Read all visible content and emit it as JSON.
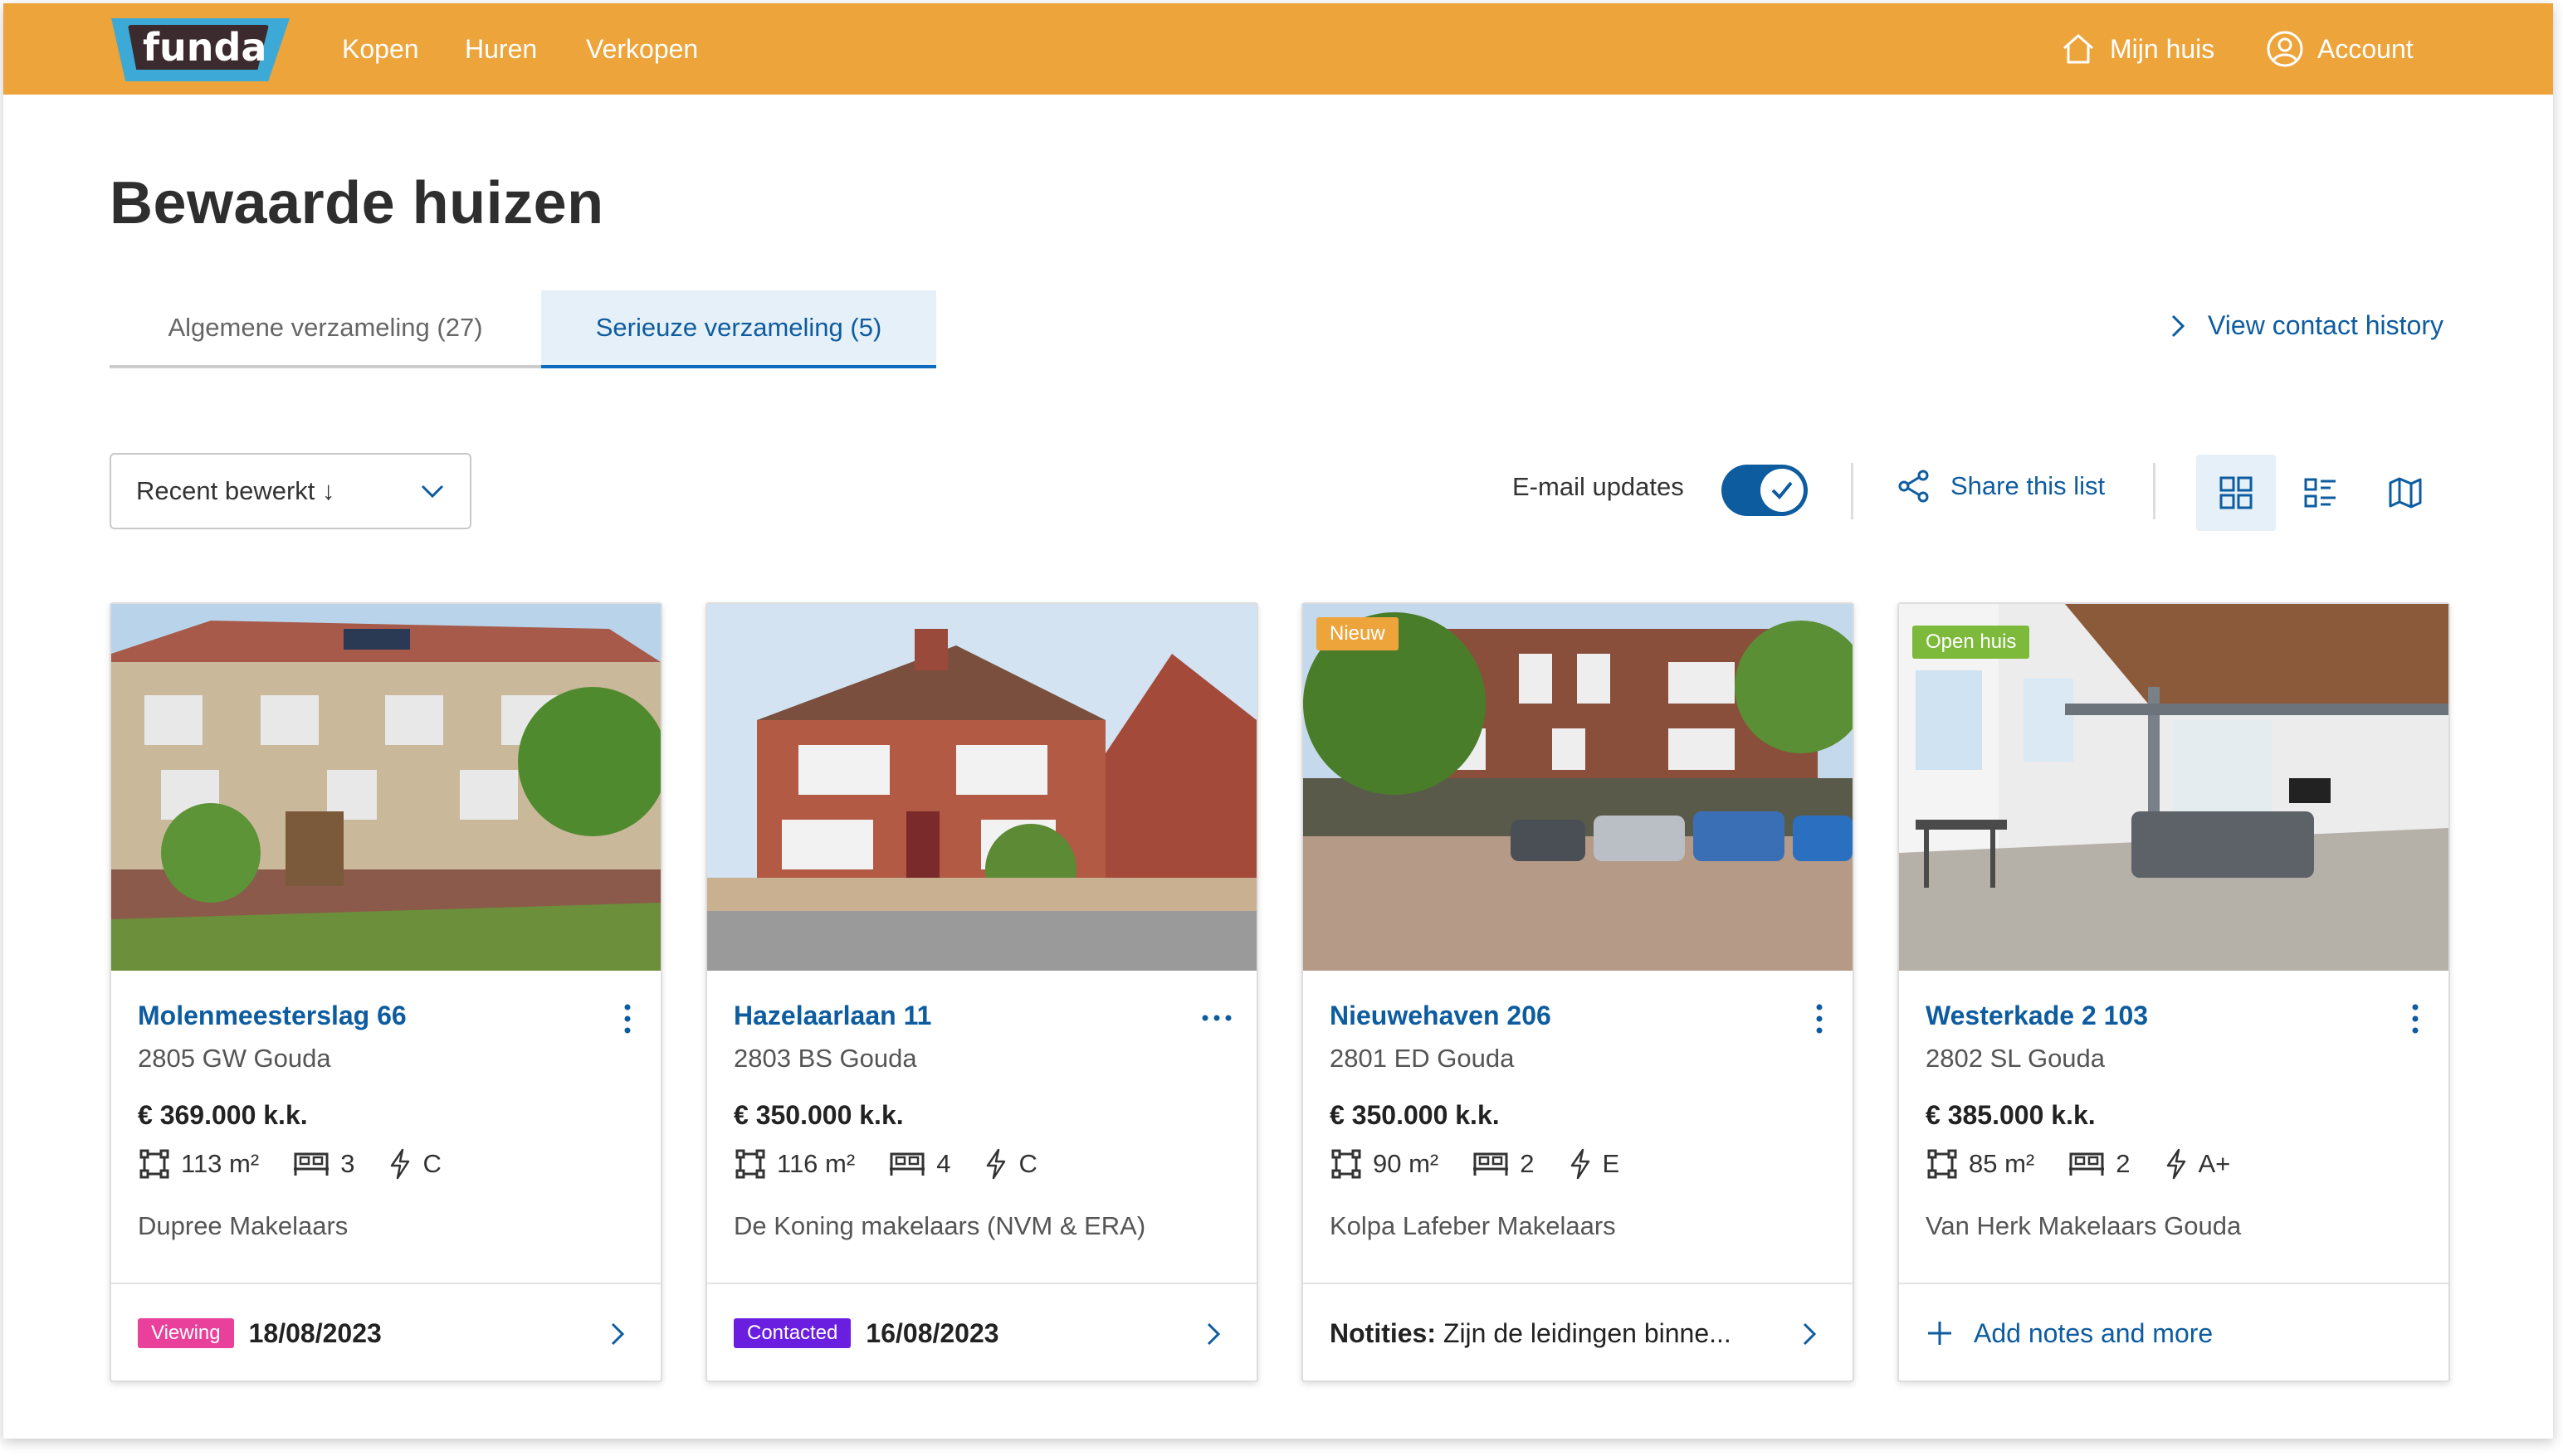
{
  "brand": {
    "logo_text": "funda",
    "accent": "#EDA43B",
    "link_color": "#0E5CA0"
  },
  "nav": {
    "items": [
      "Kopen",
      "Huren",
      "Verkopen"
    ],
    "my_home": "Mijn huis",
    "account": "Account"
  },
  "page": {
    "title": "Bewaarde huizen"
  },
  "tabs": [
    {
      "label": "Algemene verzameling (27)",
      "active": false
    },
    {
      "label": "Serieuze verzameling (5)",
      "active": true
    }
  ],
  "contact_history": "View contact history",
  "toolbar": {
    "sort_label": "Recent bewerkt ↓",
    "email_updates_label": "E-mail updates",
    "email_updates_on": true,
    "share_label": "Share this list",
    "views": [
      "grid-view-icon",
      "list-view-icon",
      "map-view-icon"
    ],
    "active_view": "grid-view-icon"
  },
  "listings": [
    {
      "address": "Molenmeesterslag 66",
      "postcode_city": "2805 GW Gouda",
      "price": "€ 369.000 k.k.",
      "area": "113 m²",
      "bedrooms": "3",
      "energy": "C",
      "agent": "Dupree Makelaars",
      "badge": "",
      "menu_icon": "vertical-dots-icon",
      "footer": {
        "type": "status",
        "label": "Viewing",
        "label_color": "#E8409B",
        "date": "18/08/2023"
      }
    },
    {
      "address": "Hazelaarlaan 11",
      "postcode_city": "2803 BS Gouda",
      "price": "€ 350.000 k.k.",
      "area": "116 m²",
      "bedrooms": "4",
      "energy": "C",
      "agent": "De Koning makelaars (NVM & ERA)",
      "badge": "",
      "menu_icon": "horizontal-dots-icon",
      "footer": {
        "type": "status",
        "label": "Contacted",
        "label_color": "#6A1FE0",
        "date": "16/08/2023"
      }
    },
    {
      "address": "Nieuwehaven 206",
      "postcode_city": "2801 ED Gouda",
      "price": "€ 350.000 k.k.",
      "area": "90 m²",
      "bedrooms": "2",
      "energy": "E",
      "agent": "Kolpa Lafeber Makelaars",
      "badge": "Nieuw",
      "badge_color": "#EDA43B",
      "menu_icon": "vertical-dots-icon",
      "footer": {
        "type": "notes",
        "prefix": "Notities:",
        "text": " Zijn de leidingen binne..."
      }
    },
    {
      "address": "Westerkade 2 103",
      "postcode_city": "2802 SL Gouda",
      "price": "€ 385.000 k.k.",
      "area": "85 m²",
      "bedrooms": "2",
      "energy": "A+",
      "agent": "Van Herk Makelaars Gouda",
      "badge": "Open huis",
      "badge_color": "#7DBA3C",
      "menu_icon": "vertical-dots-icon",
      "footer": {
        "type": "add",
        "text": "Add notes and more"
      }
    }
  ]
}
